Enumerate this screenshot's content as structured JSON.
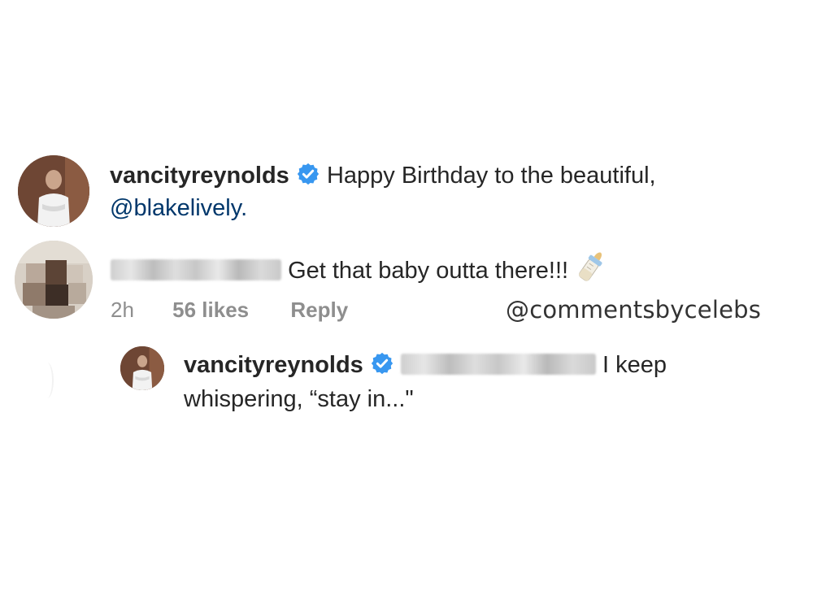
{
  "comments": [
    {
      "username": "vancityreynolds",
      "verified": true,
      "text": "Happy Birthday to the beautiful,",
      "mention": "@blakelively."
    },
    {
      "username_redacted": true,
      "text": "Get that baby outta there!!!",
      "emoji": "baby-bottle-icon",
      "meta": {
        "time": "2h",
        "likes": "56 likes",
        "reply": "Reply"
      }
    },
    {
      "username": "vancityreynolds",
      "verified": true,
      "mention_redacted": true,
      "text_line1": "I keep",
      "text_line2": "whispering, “stay in...\""
    }
  ],
  "watermark": "@commentsbycelebs",
  "colors": {
    "text": "#262626",
    "mention": "#00376b",
    "meta": "#8e8e8e",
    "verified": "#3897f0"
  }
}
